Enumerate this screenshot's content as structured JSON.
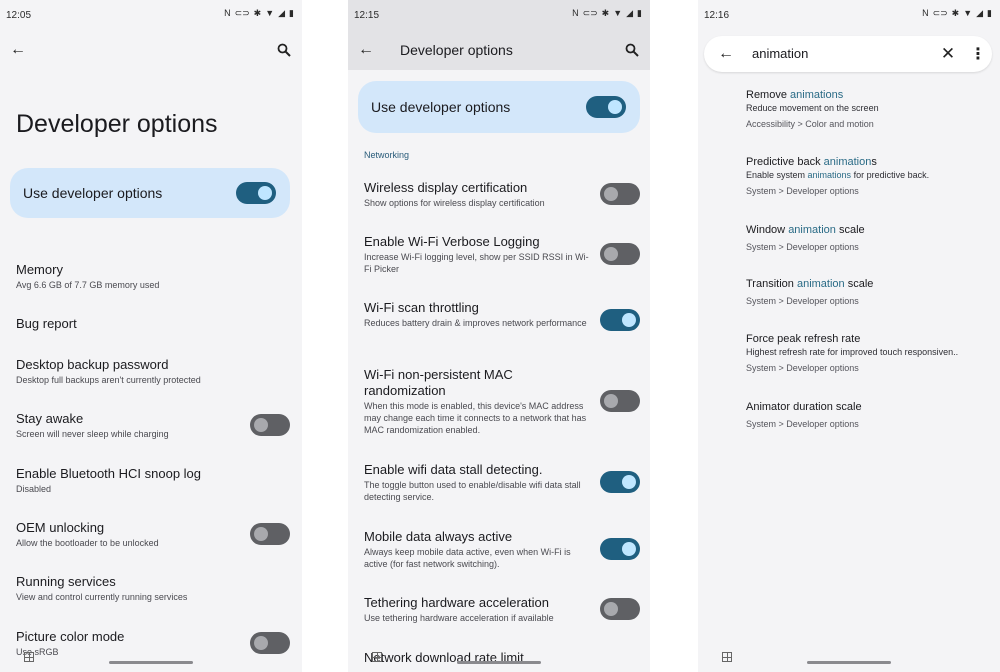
{
  "status_icons": [
    "nfc-icon",
    "link-icon",
    "bluetooth-icon",
    "wifi-icon",
    "signal-icon",
    "battery-icon"
  ],
  "screen1": {
    "time": "12:05",
    "title": "Developer options",
    "master_label": "Use developer options",
    "master_on": true,
    "rows": [
      {
        "title": "Memory",
        "sub": "Avg 6.6 GB of 7.7 GB memory used"
      },
      {
        "title": "Bug report",
        "sub": ""
      },
      {
        "title": "Desktop backup password",
        "sub": "Desktop full backups aren't currently protected"
      },
      {
        "title": "Stay awake",
        "sub": "Screen will never sleep while charging",
        "toggle": "off"
      },
      {
        "title": "Enable Bluetooth HCI snoop log",
        "sub": "Disabled"
      },
      {
        "title": "OEM unlocking",
        "sub": "Allow the bootloader to be unlocked",
        "toggle": "off"
      },
      {
        "title": "Running services",
        "sub": "View and control currently running services"
      },
      {
        "title": "Picture color mode",
        "sub": "Use sRGB",
        "toggle": "off"
      }
    ]
  },
  "screen2": {
    "time": "12:15",
    "title": "Developer options",
    "master_label": "Use developer options",
    "section": "Networking",
    "rows": [
      {
        "title": "Wireless display certification",
        "sub": "Show options for wireless display certification",
        "toggle": "off"
      },
      {
        "title": "Enable Wi-Fi Verbose Logging",
        "sub": "Increase Wi-Fi logging level, show per SSID RSSI in Wi-Fi Picker",
        "toggle": "off"
      },
      {
        "title": "Wi-Fi scan throttling",
        "sub": "Reduces battery drain & improves network performance",
        "toggle": "on"
      },
      {
        "title": "Wi-Fi non-persistent MAC randomization",
        "sub": "When this mode is enabled, this device's MAC address may change each time it connects to a network that has MAC randomization enabled.",
        "toggle": "off"
      },
      {
        "title": "Enable wifi data stall detecting.",
        "sub": "The toggle button used to enable/disable wifi data stall detecting service.",
        "toggle": "on"
      },
      {
        "title": "Mobile data always active",
        "sub": "Always keep mobile data active, even when Wi-Fi is active (for fast network switching).",
        "toggle": "on"
      },
      {
        "title": "Tethering hardware acceleration",
        "sub": "Use tethering hardware acceleration if available",
        "toggle": "off"
      },
      {
        "title": "Network download rate limit",
        "sub": ""
      }
    ]
  },
  "screen3": {
    "time": "12:16",
    "query": "animation",
    "results": [
      {
        "title_pre": "Remove ",
        "title_hl": "animations",
        "title_post": "",
        "desc_pre": "Reduce movement on the screen",
        "desc_hl": "",
        "desc_post": "",
        "path": "Accessibility > Color and motion"
      },
      {
        "title_pre": "Predictive back ",
        "title_hl": "animation",
        "title_post": "s",
        "desc_pre": "Enable system ",
        "desc_hl": "animations",
        "desc_post": " for predictive back.",
        "path": "System > Developer options"
      },
      {
        "title_pre": "Window ",
        "title_hl": "animation",
        "title_post": " scale",
        "desc_pre": "",
        "desc_hl": "",
        "desc_post": "",
        "path": "System > Developer options"
      },
      {
        "title_pre": "Transition ",
        "title_hl": "animation",
        "title_post": " scale",
        "desc_pre": "",
        "desc_hl": "",
        "desc_post": "",
        "path": "System > Developer options"
      },
      {
        "title_pre": "Force peak refresh rate",
        "title_hl": "",
        "title_post": "",
        "desc_pre": "Highest refresh rate for improved touch responsiven..",
        "desc_hl": "",
        "desc_post": "",
        "path": "System > Developer options"
      },
      {
        "title_pre": "Animator duration scale",
        "title_hl": "",
        "title_post": "",
        "desc_pre": "",
        "desc_hl": "",
        "desc_post": "",
        "path": "System > Developer options"
      }
    ]
  }
}
